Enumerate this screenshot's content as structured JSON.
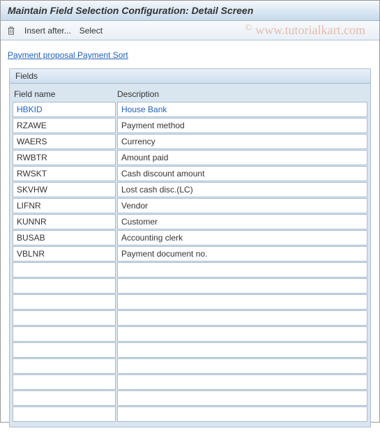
{
  "title": "Maintain Field Selection Configuration: Detail Screen",
  "toolbar": {
    "insert_after": "Insert after...",
    "select": "Select"
  },
  "link": "Payment proposal Payment Sort",
  "groupbox_title": "Fields",
  "columns": {
    "field_name": "Field name",
    "description": "Description"
  },
  "rows": [
    {
      "name": "HBKID",
      "desc": "House Bank",
      "highlight": true
    },
    {
      "name": "RZAWE",
      "desc": "Payment method"
    },
    {
      "name": "WAERS",
      "desc": "Currency"
    },
    {
      "name": "RWBTR",
      "desc": "Amount paid"
    },
    {
      "name": "RWSKT",
      "desc": "Cash discount amount"
    },
    {
      "name": "SKVHW",
      "desc": "Lost cash disc.(LC)"
    },
    {
      "name": "LIFNR",
      "desc": "Vendor"
    },
    {
      "name": "KUNNR",
      "desc": "Customer"
    },
    {
      "name": "BUSAB",
      "desc": "Accounting clerk"
    },
    {
      "name": "VBLNR",
      "desc": "Payment document no."
    },
    {
      "name": "",
      "desc": ""
    },
    {
      "name": "",
      "desc": ""
    },
    {
      "name": "",
      "desc": ""
    },
    {
      "name": "",
      "desc": ""
    },
    {
      "name": "",
      "desc": ""
    },
    {
      "name": "",
      "desc": ""
    },
    {
      "name": "",
      "desc": ""
    },
    {
      "name": "",
      "desc": ""
    },
    {
      "name": "",
      "desc": ""
    },
    {
      "name": "",
      "desc": ""
    }
  ],
  "watermark": "www.tutorialkart.com"
}
